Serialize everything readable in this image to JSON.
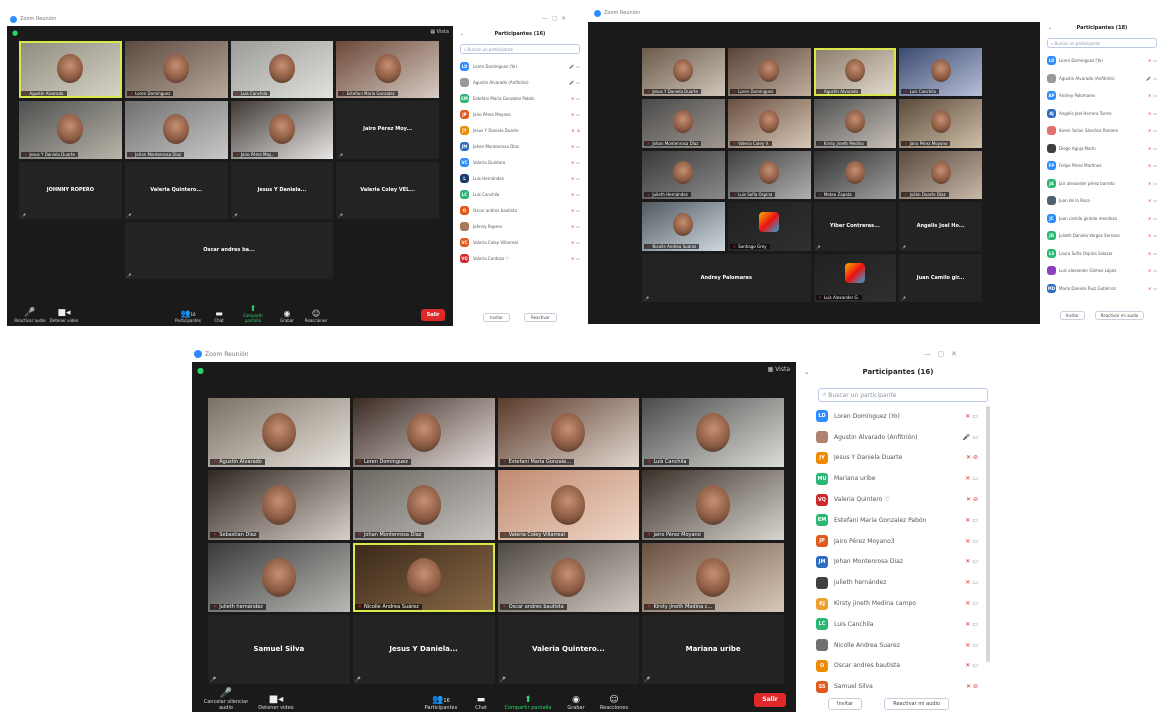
{
  "shot1": {
    "app_title": "Zoom Reunión",
    "view_label": "Vista",
    "tiles": [
      {
        "type": "cam",
        "name": "Agustin Alvarado",
        "a": "#8e8a7c",
        "b": "#d8d4c8",
        "speaking": true
      },
      {
        "type": "cam",
        "name": "Loren Domínguez",
        "a": "#5a4a40",
        "b": "#b8a89a"
      },
      {
        "type": "cam",
        "name": "Luis Canchila",
        "a": "#9a9c98",
        "b": "#e2e2dc"
      },
      {
        "type": "cam",
        "name": "Estefani Maria Gonzalez",
        "a": "#6c4838",
        "b": "#d8ccc4"
      },
      {
        "type": "cam",
        "name": "Jesus Y Daniela Duarte",
        "a": "#505050",
        "b": "#b8b4a8"
      },
      {
        "type": "cam",
        "name": "Johan Montenrosa Diaz",
        "a": "#707070",
        "b": "#c8c8c8"
      },
      {
        "type": "cam",
        "name": "Jairo Pérez Moy...",
        "a": "#403a36",
        "b": "#e8e6e4"
      },
      {
        "type": "name",
        "big": "Jairo Pérez Moy..."
      },
      {
        "type": "name",
        "big": "JOHNNY ROPERO"
      },
      {
        "type": "name",
        "big": "Valeria Quintero..."
      },
      {
        "type": "name",
        "big": "Jesus Y Daniela..."
      },
      {
        "type": "name",
        "big": "Valeria Coley VEL..."
      },
      {
        "type": "name",
        "big": "Oscar andres ba..."
      }
    ],
    "toolbar": {
      "mute": "Reactivar audio",
      "video": "Detener video",
      "participants": "Participantes",
      "participants_count": "16",
      "chat": "Chat",
      "share": "Compartir pantalla",
      "record": "Grabar",
      "reactions": "Reacciones",
      "leave": "Salir"
    },
    "panel": {
      "title": "Participantes (16)",
      "search_placeholder": "Buscar un participante",
      "rows": [
        {
          "ini": "LD",
          "color": "#2d8cff",
          "name": "Loren Domínguez (Yo)",
          "mic_on": true
        },
        {
          "ini": "",
          "color": "#9a9a9a",
          "name": "Agustin Alvarado (Anfitrión)",
          "mic_on": true
        },
        {
          "ini": "EM",
          "color": "#2bb673",
          "name": "Estefani Maria Gonzalez Pabón"
        },
        {
          "ini": "JP",
          "color": "#e05a1e",
          "name": "Jairo Pérez Moyano"
        },
        {
          "ini": "JY",
          "color": "#f08a00",
          "name": "Jesus Y Daniela Duarte",
          "video_off": true
        },
        {
          "ini": "JM",
          "color": "#2d6cc0",
          "name": "Johan Montenrosa Díaz"
        },
        {
          "ini": "VC",
          "color": "#2d8cff",
          "name": "Valeria Quintero"
        },
        {
          "ini": "L",
          "color": "#1a3a6a",
          "name": "Luis Hernández"
        },
        {
          "ini": "LC",
          "color": "#2bb673",
          "name": "Luis Canchila"
        },
        {
          "ini": "O",
          "color": "#e05a1e",
          "name": "Oscar andres bautista"
        },
        {
          "ini": "",
          "color": "#a87a5a",
          "name": "Johnny Ropero"
        },
        {
          "ini": "VC",
          "color": "#e05a1e",
          "name": "Valeria Coley Villarreal"
        },
        {
          "ini": "VQ",
          "color": "#d02828",
          "name": "Valeria Cardozo ♡"
        }
      ],
      "invite": "Invitar",
      "unmute_all": "Reactivar"
    }
  },
  "shot2": {
    "app_title": "Zoom Reunión",
    "tiles": [
      {
        "type": "cam",
        "name": "Jesus Y Daniela Duarte",
        "a": "#6a5a4a",
        "b": "#cfc6ba"
      },
      {
        "type": "cam",
        "name": "Loren Domínguez",
        "a": "#5a4438",
        "b": "#c0aea0"
      },
      {
        "type": "cam",
        "name": "Agustin Alvarado",
        "a": "#8a7a6a",
        "b": "#e4ddd0",
        "speaking": true
      },
      {
        "type": "cam",
        "name": "Luis Canchila",
        "a": "#3a4a70",
        "b": "#b8c0d8"
      },
      {
        "type": "cam",
        "name": "Johan Montenrosa Díaz",
        "a": "#4a4a4a",
        "b": "#a09890"
      },
      {
        "type": "cam",
        "name": "Valeria Coley V.",
        "a": "#6a5040",
        "b": "#d8c8b8"
      },
      {
        "type": "cam",
        "name": "Kirsty Jineth Medina",
        "a": "#505050",
        "b": "#c8c0b8"
      },
      {
        "type": "cam",
        "name": "Jairo Pérez Moyano",
        "a": "#5a4a3a",
        "b": "#d0c0a8"
      },
      {
        "type": "cam",
        "name": "Julieth Hernández",
        "a": "#3a3a3a",
        "b": "#8a8a8a"
      },
      {
        "type": "cam",
        "name": "Luis Sofía Ospina",
        "a": "#404040",
        "b": "#b0b0b0"
      },
      {
        "type": "cam",
        "name": "Mateo Zapata",
        "a": "#303030",
        "b": "#a0a0a0"
      },
      {
        "type": "cam",
        "name": "Julián Duarte Díaz",
        "a": "#5a4a40",
        "b": "#c8b8a8"
      },
      {
        "type": "cam",
        "name": "Nicolle Andrea Suárez",
        "a": "#505860",
        "b": "#d0d8e0"
      },
      {
        "type": "avatar",
        "name": "Santiago Grey"
      },
      {
        "type": "name",
        "big": "Yiber Contreras..."
      },
      {
        "type": "name",
        "big": "Angelis Joel Ho..."
      },
      {
        "type": "name",
        "big": "Andrey Palomares"
      },
      {
        "type": "avatar",
        "name": "Luis Alexander G."
      },
      {
        "type": "name",
        "big": "Juan Camilo gir..."
      }
    ],
    "panel": {
      "title": "Participantes (18)",
      "search_placeholder": "Buscar un participante",
      "rows": [
        {
          "ini": "LD",
          "color": "#2d8cff",
          "name": "Loren Domínguez (Yo)"
        },
        {
          "ini": "",
          "color": "#9a9a9a",
          "name": "Agustin Alvarado (Anfitrión)",
          "mic_on": true
        },
        {
          "ini": "AP",
          "color": "#2d8cff",
          "name": "Andrey Palomares"
        },
        {
          "ini": "AJ",
          "color": "#2d6cc0",
          "name": "Angelis Joel Herrera Torres"
        },
        {
          "ini": "",
          "color": "#e07070",
          "name": "Karen Yulian Sánchez Romero"
        },
        {
          "ini": "",
          "color": "#404040",
          "name": "Diego Aguja Marín"
        },
        {
          "ini": "FP",
          "color": "#2d8cff",
          "name": "Felipe Pérez Martínez"
        },
        {
          "ini": "JA",
          "color": "#2bb673",
          "name": "Jair alexander pérez barreto"
        },
        {
          "ini": "",
          "color": "#506070",
          "name": "Juan de la Rosa"
        },
        {
          "ini": "JC",
          "color": "#2d8cff",
          "name": "Juan camilo giraldo mendoza"
        },
        {
          "ini": "JD",
          "color": "#2bb673",
          "name": "Julieth Daniela Vargas Serrano"
        },
        {
          "ini": "LS",
          "color": "#2bb673",
          "name": "Laura Sofía Ospina Salazar"
        },
        {
          "ini": "",
          "color": "#8a40c0",
          "name": "Luis alexander Gómez López"
        },
        {
          "ini": "MD",
          "color": "#2d6cc0",
          "name": "María Daniela Ruiz Gutiérrez"
        }
      ],
      "invite": "Invitar",
      "unmute_all": "Reactivar mi audio"
    }
  },
  "shot3": {
    "app_title": "Zoom Reunión",
    "view_label": "Vista",
    "tiles": [
      {
        "type": "cam",
        "name": "Agustin Alvarado",
        "a": "#7a7064",
        "b": "#e8e4dc"
      },
      {
        "type": "cam",
        "name": "Loren Domínguez",
        "a": "#3a2a22",
        "b": "#e6dedc"
      },
      {
        "type": "cam",
        "name": "Estefani Maria Gonzale...",
        "a": "#5a3a2a",
        "b": "#e2d8d0"
      },
      {
        "type": "cam",
        "name": "Luis Canchila",
        "a": "#4a4a4a",
        "b": "#dcdcd8"
      },
      {
        "type": "cam",
        "name": "Sebastian Díaz",
        "a": "#302820",
        "b": "#d8d0c8"
      },
      {
        "type": "cam",
        "name": "Johan Montenrosa Díaz",
        "a": "#6a6660",
        "b": "#c8c6c2"
      },
      {
        "type": "cam",
        "name": "Valeria Coley Villarreal",
        "a": "#c08a70",
        "b": "#f0d8c8"
      },
      {
        "type": "cam",
        "name": "Jairo Pérez Moyano",
        "a": "#3a3028",
        "b": "#d8d6d0"
      },
      {
        "type": "cam",
        "name": "Julieth hernández",
        "a": "#3a3a3a",
        "b": "#b8b8b4"
      },
      {
        "type": "cam",
        "name": "Nicolle Andrea Suárez",
        "a": "#3a2818",
        "b": "#8a6a48",
        "speaking": true
      },
      {
        "type": "cam",
        "name": "Oscar andres bautista",
        "a": "#504a44",
        "b": "#d0c8c0"
      },
      {
        "type": "cam",
        "name": "Kirsty jineth Medina c...",
        "a": "#6a5040",
        "b": "#d8c8b8"
      },
      {
        "type": "name",
        "big": "Samuel Silva"
      },
      {
        "type": "name",
        "big": "Jesus Y Daniela..."
      },
      {
        "type": "name",
        "big": "Valeria Quintero..."
      },
      {
        "type": "name",
        "big": "Mariana uribe"
      }
    ],
    "toolbar": {
      "mute": "Cancelar silenciar audio",
      "video": "Detener video",
      "participants": "Participantes",
      "participants_count": "16",
      "chat": "Chat",
      "share": "Compartir pantalla",
      "record": "Grabar",
      "reactions": "Reacciones",
      "leave": "Salir"
    },
    "panel": {
      "title": "Participantes (16)",
      "search_placeholder": "Buscar un participante",
      "rows": [
        {
          "ini": "LD",
          "color": "#2d8cff",
          "name": "Loren Domínguez (Yo)"
        },
        {
          "ini": "",
          "color": "#b08070",
          "name": "Agustin Alvarado (Anfitrión)",
          "mic_on": true
        },
        {
          "ini": "JY",
          "color": "#f08a00",
          "name": "Jesus Y Daniela Duarte",
          "video_off": true
        },
        {
          "ini": "MU",
          "color": "#2bb673",
          "name": "Mariana uribe"
        },
        {
          "ini": "VQ",
          "color": "#d02828",
          "name": "Valeria Quintero ♡",
          "video_off": true
        },
        {
          "ini": "EM",
          "color": "#2bb673",
          "name": "Estefani Maria Gonzalez Pabón"
        },
        {
          "ini": "JP",
          "color": "#e05a1e",
          "name": "Jairo Pérez Moyano3"
        },
        {
          "ini": "JM",
          "color": "#2d6cc0",
          "name": "Johan Montenrosa Diaz"
        },
        {
          "ini": "",
          "color": "#404040",
          "name": "julieth hernández"
        },
        {
          "ini": "KJ",
          "color": "#f0a030",
          "name": "Kirsty jineth Medina campo"
        },
        {
          "ini": "LC",
          "color": "#2bb673",
          "name": "Luis Canchila"
        },
        {
          "ini": "",
          "color": "#707070",
          "name": "Nicolle Andrea Suarez"
        },
        {
          "ini": "O",
          "color": "#f08a00",
          "name": "Oscar andres bautista"
        },
        {
          "ini": "SS",
          "color": "#e05a1e",
          "name": "Samuel Silva",
          "video_off": true
        }
      ],
      "invite": "Invitar",
      "unmute_all": "Reactivar mi audio"
    }
  }
}
